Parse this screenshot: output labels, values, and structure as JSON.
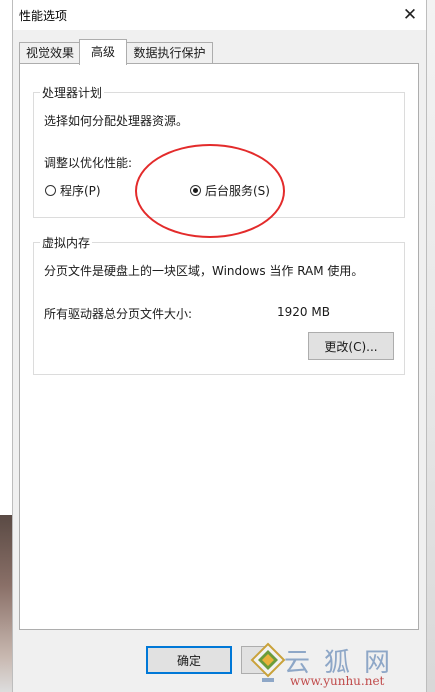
{
  "window": {
    "title": "性能选项",
    "close_glyph": "✕"
  },
  "tabs": [
    {
      "label": "视觉效果",
      "active": false
    },
    {
      "label": "高级",
      "active": true
    },
    {
      "label": "数据执行保护",
      "active": false
    }
  ],
  "processor_group": {
    "legend": "处理器计划",
    "description": "选择如何分配处理器资源。",
    "adjust_label": "调整以优化性能:",
    "options": [
      {
        "label": "程序(P)",
        "selected": false
      },
      {
        "label": "后台服务(S)",
        "selected": true
      }
    ]
  },
  "virtual_memory_group": {
    "legend": "虚拟内存",
    "description": "分页文件是硬盘上的一块区域，Windows 当作 RAM 使用。",
    "total_label": "所有驱动器总分页文件大小:",
    "total_value": "1920 MB",
    "change_button": "更改(C)..."
  },
  "footer": {
    "ok_button": "确定"
  },
  "watermark": {
    "text": "云狐网",
    "url": "www.yunhu.net"
  },
  "colors": {
    "annotation": "#e32b2b",
    "focus_border": "#0078d7"
  },
  "icons": {
    "close": "close-icon",
    "watermark_logo": "fox-logo-icon"
  }
}
